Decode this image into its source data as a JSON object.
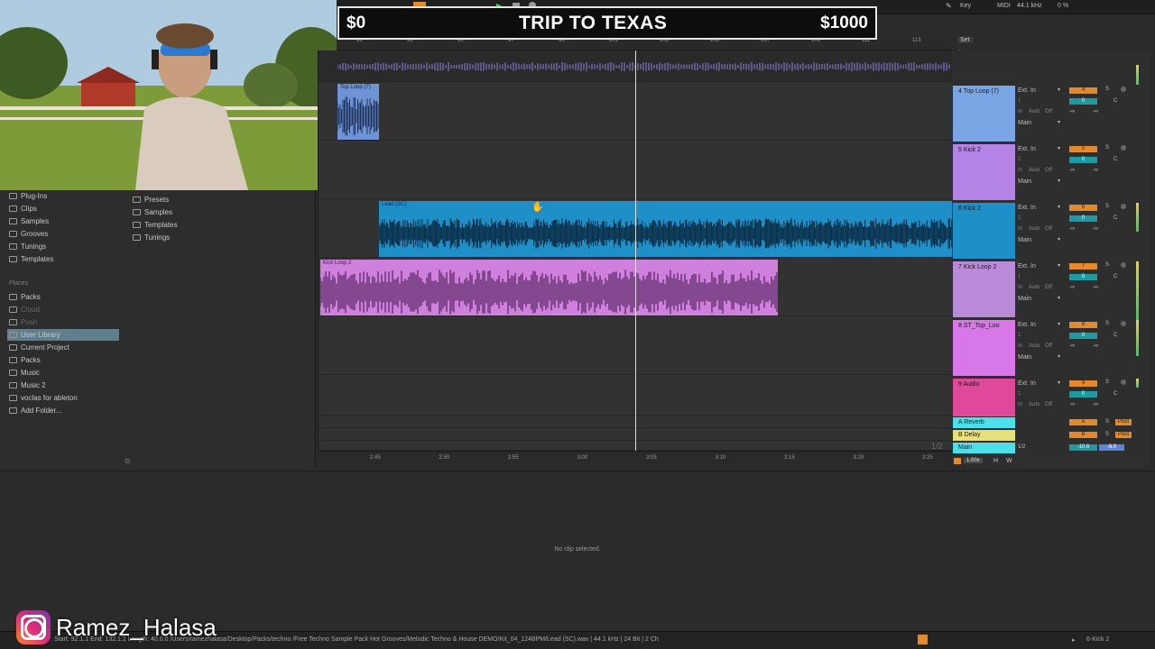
{
  "overlay": {
    "left": "$0",
    "center": "TRIP TO TEXAS",
    "right": "$1000"
  },
  "topbar": {
    "key": "Key",
    "midi": "MIDI",
    "rate": "44.1 kHz",
    "cpu": "0 %",
    "set": "Set"
  },
  "browser": {
    "categories": [
      "Plug-Ins",
      "Clips",
      "Samples",
      "Grooves",
      "Tunings",
      "Templates"
    ],
    "places_label": "Places",
    "places": [
      "Packs",
      "Cloud",
      "Push",
      "User Library",
      "Current Project",
      "Packs",
      "Music",
      "Music 2",
      "voclas for ableton",
      "Add Folder..."
    ],
    "folders": [
      "Presets",
      "Samples",
      "Templates",
      "Tunings"
    ]
  },
  "ruler_top": [
    "91",
    "93",
    "95",
    "97",
    "99",
    "101",
    "103",
    "105",
    "107",
    "109",
    "111",
    "113"
  ],
  "ruler_bottom": [
    "2:45",
    "2:50",
    "2:55",
    "3:00",
    "3:05",
    "3:10",
    "3:15",
    "3:20",
    "3:25"
  ],
  "clips": {
    "top_loop": "Top Loop (7)",
    "lead": "Lead (SC)",
    "kick_loop": "Kick Loop 2"
  },
  "tracks": [
    {
      "name": "4 Top Loop (7)",
      "num": "4",
      "input": "Ext. In",
      "out": "Main"
    },
    {
      "name": "5 Kick 2",
      "num": "5",
      "input": "Ext. In",
      "out": "Main"
    },
    {
      "name": "6 Kick 2",
      "num": "6",
      "input": "Ext. In",
      "out": "Main"
    },
    {
      "name": "7 Kick Loop 2",
      "num": "7",
      "input": "Ext. In",
      "out": "Main"
    },
    {
      "name": "8 ST_Top_Loo",
      "num": "8",
      "input": "Ext. In",
      "out": "Main"
    },
    {
      "name": "9 Audio",
      "num": "9",
      "input": "Ext. In",
      "out": "Main"
    }
  ],
  "returns": [
    {
      "name": "A Reverb",
      "letter": "A",
      "post": "Post"
    },
    {
      "name": "B Delay",
      "letter": "B",
      "post": "Post"
    },
    {
      "name": "Main",
      "vol": "-10.6",
      "peak": "-6.0",
      "ratio": "1/2"
    }
  ],
  "mixer_labels": {
    "in": "In",
    "auto": "Auto",
    "off": "Off",
    "s": "S",
    "c": "C",
    "zero": "0",
    "inf": "-∞",
    "one": "1"
  },
  "zoom": "1.00x",
  "page_ratio": "1/2",
  "hw": {
    "h": "H",
    "w": "W"
  },
  "detail": {
    "no_clip": "No clip selected."
  },
  "status": {
    "path": "Start: 92.1.1  End: 132.1.1  Length: 40.0.0  /Users/ramezhalasa/Desktop/Packs/techno /Free Techno Sample Pack Hot Grooves/Melodic Techno & House DEMO/Kit_04_124BPM/Lead (SC).wav | 44.1 kHz | 24 Bit | 2 Ch",
    "track": "6-Kick 2"
  },
  "watermark": "Ramez_Halasa",
  "colors": {
    "blue_clip": "#1f8fc8",
    "pink_clip": "#cf7fdc",
    "light_blue": "#7ba6e6"
  }
}
